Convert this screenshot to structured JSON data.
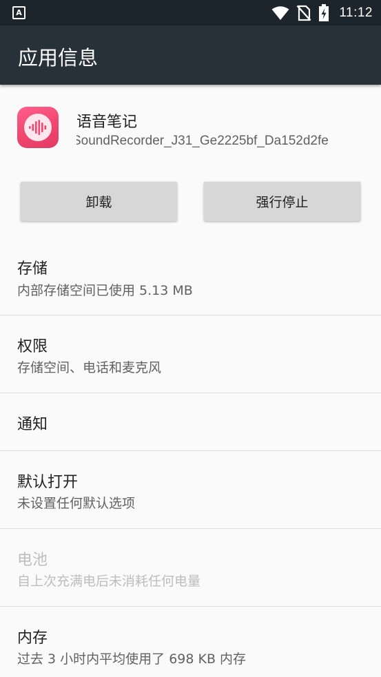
{
  "status_bar": {
    "left_icon_label": "A",
    "time": "11:12",
    "icons": [
      "wifi-icon",
      "no-sim-icon",
      "battery-charging-icon"
    ]
  },
  "app_bar": {
    "title": "应用信息"
  },
  "app": {
    "name": "语音笔记",
    "package": "SoundRecorder_J31_Ge2225bf_Da152d2fe",
    "icon": "sound-wave-icon"
  },
  "buttons": {
    "uninstall": "卸载",
    "force_stop": "强行停止"
  },
  "items": [
    {
      "title": "存储",
      "summary": "内部存储空间已使用 5.13 MB"
    },
    {
      "title": "权限",
      "summary": "存储空间、电话和麦克风"
    },
    {
      "title": "通知",
      "summary": ""
    },
    {
      "title": "默认打开",
      "summary": "未设置任何默认选项"
    },
    {
      "title": "电池",
      "summary": "自上次充满电后未消耗任何电量"
    },
    {
      "title": "内存",
      "summary": "过去 3 小时内平均使用了 698 KB 内存"
    }
  ],
  "colors": {
    "status_bar": "#1c252b",
    "app_bar": "#263238",
    "background": "#fafafa",
    "icon_accent": "#f0466f",
    "button": "#d7d7d7",
    "disabled_text": "#bdbdbd"
  }
}
